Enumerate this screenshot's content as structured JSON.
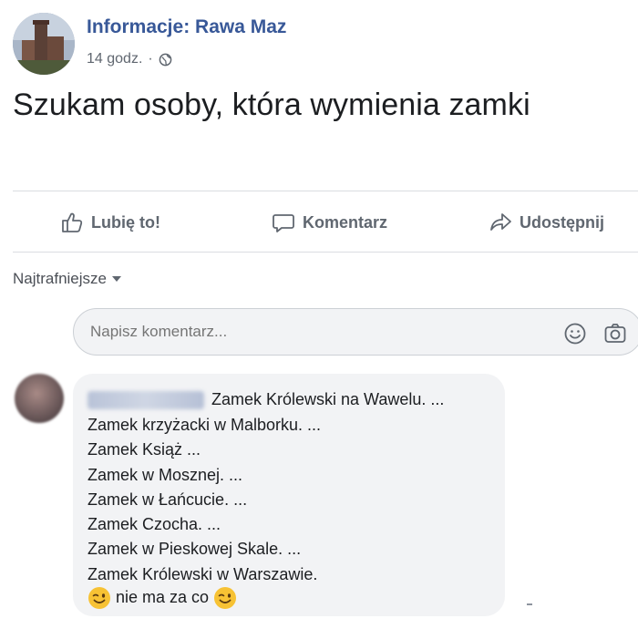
{
  "post": {
    "page_name": "Informacje: Rawa Maz",
    "time": "14 godz.",
    "separator": "·",
    "privacy_icon": "globe-icon",
    "text": "Szukam osoby, która wymienia zamki"
  },
  "actions": {
    "like_label": "Lubię to!",
    "comment_label": "Komentarz",
    "share_label": "Udostępnij"
  },
  "comments_section": {
    "sort_label": "Najtrafniejsze",
    "composer_placeholder": "Napisz komentarz...",
    "composer_icons": [
      "emoji-icon",
      "camera-icon"
    ]
  },
  "comment": {
    "lines": [
      "Zamek Królewski na Wawelu. ...",
      "Zamek krzyżacki w Malborku. ...",
      "Zamek Książ ...",
      "Zamek w Mosznej. ...",
      "Zamek w Łańcucie. ...",
      "Zamek Czocha. ...",
      "Zamek w Pieskowej Skale. ...",
      "Zamek Królewski w Warszawie.",
      "nie ma za co"
    ]
  },
  "colors": {
    "link_blue": "#385898",
    "secondary_text": "#606770",
    "bubble_bg": "#f2f3f5",
    "divider": "#dadde1"
  }
}
